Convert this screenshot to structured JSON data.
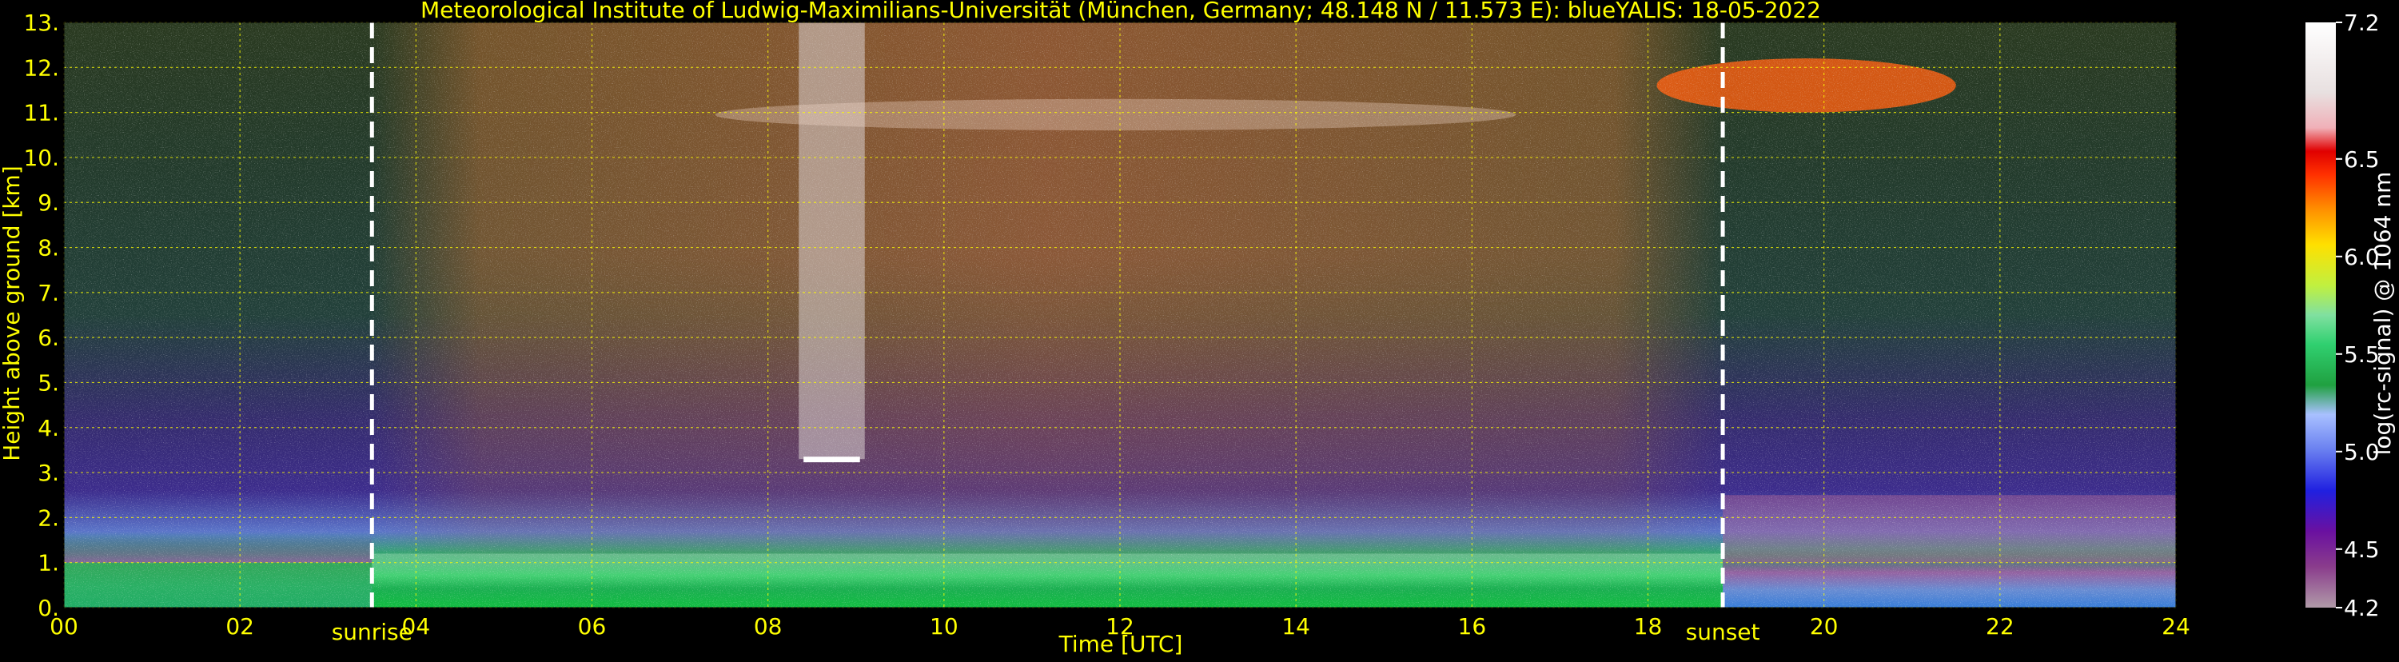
{
  "chart_data": {
    "type": "heatmap",
    "title": "Meteorological Institute of Ludwig-Maximilians-Universität (München, Germany; 48.148 N / 11.573 E):     blueYALIS: 18-05-2022",
    "xlabel": "Time [UTC]",
    "ylabel": "Height above ground [km]",
    "xlim": [
      0,
      24
    ],
    "ylim": [
      0,
      13
    ],
    "x_ticks": [
      "00",
      "02",
      "04",
      "06",
      "08",
      "10",
      "12",
      "14",
      "16",
      "18",
      "20",
      "22",
      "24"
    ],
    "y_ticks": [
      "0.",
      "1.",
      "2.",
      "3.",
      "4.",
      "5.",
      "6.",
      "7.",
      "8.",
      "9.",
      "10.",
      "11.",
      "12.",
      "13."
    ],
    "grid": true,
    "colorbar": {
      "label": "log(rc-signal) @ 1064 nm",
      "range": [
        4.2,
        7.2
      ],
      "ticks": [
        "4.2",
        "4.5",
        "5.0",
        "5.5",
        "6.0",
        "6.5",
        "7.2"
      ]
    },
    "annotations": [
      {
        "label": "sunrise",
        "time_utc": 3.5
      },
      {
        "label": "sunset",
        "time_utc": 18.85
      }
    ],
    "notable_features": [
      {
        "feature": "aerosol boundary layer",
        "time_range": [
          0,
          24
        ],
        "height_km": [
          0,
          1.3
        ]
      },
      {
        "feature": "thin cloud layer",
        "time_utc": [
          8.35,
          9.1
        ],
        "height_km": 3.3
      },
      {
        "feature": "cirrus",
        "time_utc": [
          7.4,
          16.5
        ],
        "height_km": [
          10.6,
          11.3
        ]
      },
      {
        "feature": "cirrus",
        "time_utc": [
          18.1,
          21.5
        ],
        "height_km": [
          11,
          12.2
        ]
      }
    ]
  },
  "colors": {
    "background": "#000000",
    "text": "#ffff00",
    "colorbar_text": "#ffffff",
    "grid": "#ffff00",
    "marker_line": "#ffffff"
  }
}
